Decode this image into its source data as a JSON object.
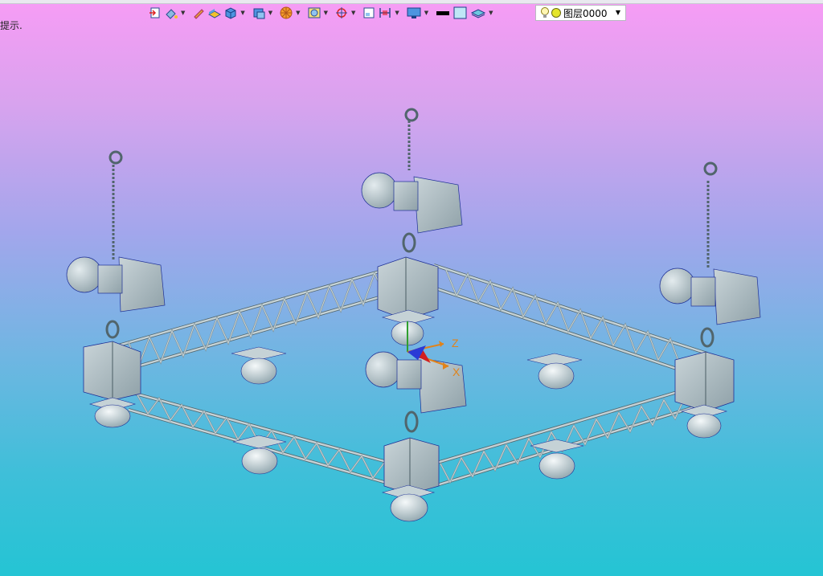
{
  "hint": {
    "text": "提示."
  },
  "layer": {
    "name": "图层0000"
  },
  "triad": {
    "z_label": "Z",
    "x_label": "X"
  },
  "colors": {
    "truss": "#b5c3c8",
    "edge": "#1d2f96",
    "axis_z": "#e0831b",
    "axis_x": "#d21f1f",
    "axis_y": "#2f9f2f"
  }
}
